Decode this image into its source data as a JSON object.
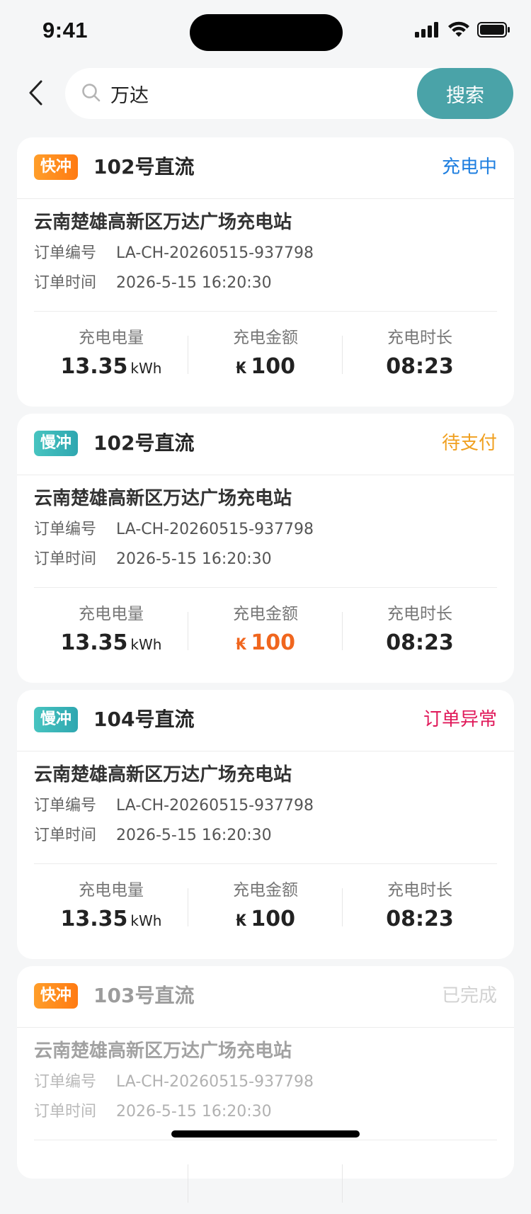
{
  "status_bar": {
    "time": "9:41",
    "signal_icon": "cellular-signal-icon",
    "wifi_icon": "wifi-icon",
    "battery_icon": "battery-icon"
  },
  "search": {
    "back_icon": "chevron-left-icon",
    "icon": "search-icon",
    "value": "万达",
    "placeholder": "",
    "button_label": "搜索"
  },
  "orders": [
    {
      "tag": "快冲",
      "pile": "102号直流",
      "status": "充电中",
      "status_color": "#1f7fe0",
      "station": "云南楚雄高新区万达广场充电站",
      "order_no_label": "订单编号",
      "order_no": "LA-CH-20260515-937798",
      "order_time_label": "订单时间",
      "order_time": "2026-5-15 16:20:30",
      "energy_label": "充电电量",
      "energy": "13.35",
      "energy_unit": "kWh",
      "amount_label": "充电金额",
      "amount_currency": "₭",
      "amount": "100",
      "amount_color": "#222222",
      "duration_label": "充电时长",
      "duration": "08:23"
    },
    {
      "tag": "慢冲",
      "pile": "102号直流",
      "status": "待支付",
      "status_color": "#f0a020",
      "station": "云南楚雄高新区万达广场充电站",
      "order_no_label": "订单编号",
      "order_no": "LA-CH-20260515-937798",
      "order_time_label": "订单时间",
      "order_time": "2026-5-15 16:20:30",
      "energy_label": "充电电量",
      "energy": "13.35",
      "energy_unit": "kWh",
      "amount_label": "充电金额",
      "amount_currency": "₭",
      "amount": "100",
      "amount_color": "#f0661e",
      "duration_label": "充电时长",
      "duration": "08:23"
    },
    {
      "tag": "慢冲",
      "pile": "104号直流",
      "status": "订单异常",
      "status_color": "#e0195a",
      "station": "云南楚雄高新区万达广场充电站",
      "order_no_label": "订单编号",
      "order_no": "LA-CH-20260515-937798",
      "order_time_label": "订单时间",
      "order_time": "2026-5-15 16:20:30",
      "energy_label": "充电电量",
      "energy": "13.35",
      "energy_unit": "kWh",
      "amount_label": "充电金额",
      "amount_currency": "₭",
      "amount": "100",
      "amount_color": "#222222",
      "duration_label": "充电时长",
      "duration": "08:23"
    },
    {
      "tag": "快冲",
      "pile": "103号直流",
      "status": "已完成",
      "status_color": "#c8c8c8",
      "station": "云南楚雄高新区万达广场充电站",
      "order_no_label": "订单编号",
      "order_no": "LA-CH-20260515-937798",
      "order_time_label": "订单时间",
      "order_time": "2026-5-15 16:20:30"
    }
  ]
}
